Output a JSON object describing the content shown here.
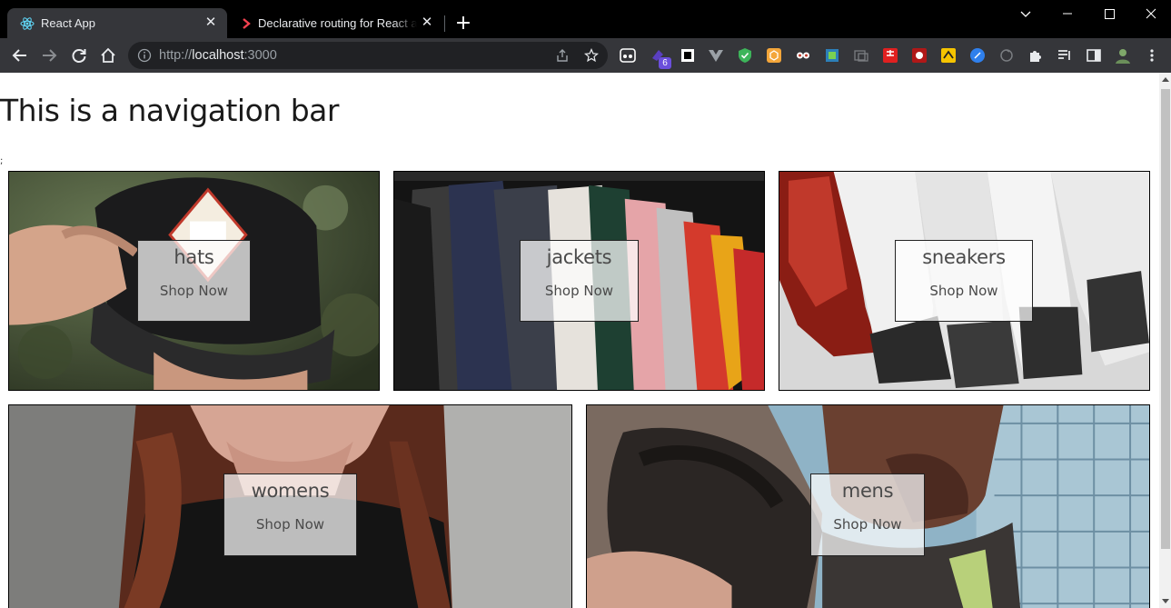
{
  "browser": {
    "tabs": [
      {
        "title": "React App",
        "active": true
      },
      {
        "title": "Declarative routing for React apps at any scale | React Router",
        "active": false
      }
    ],
    "address": {
      "prefix": "http://",
      "host": "localhost",
      "port": ":3000"
    },
    "extension_badge": "6"
  },
  "page": {
    "nav_title": "This is a navigation bar",
    "stray_text": ";",
    "categories": [
      {
        "title": "hats",
        "subtitle": "Shop Now"
      },
      {
        "title": "jackets",
        "subtitle": "Shop Now"
      },
      {
        "title": "sneakers",
        "subtitle": "Shop Now"
      },
      {
        "title": "womens",
        "subtitle": "Shop Now"
      },
      {
        "title": "mens",
        "subtitle": "Shop Now"
      }
    ]
  },
  "colors": {
    "tab_active": "#35363a",
    "toolbar": "#35363a",
    "omnibox": "#202124",
    "page_bg": "#ffffff",
    "card_overlay": "rgba(255,255,255,0.72)"
  }
}
